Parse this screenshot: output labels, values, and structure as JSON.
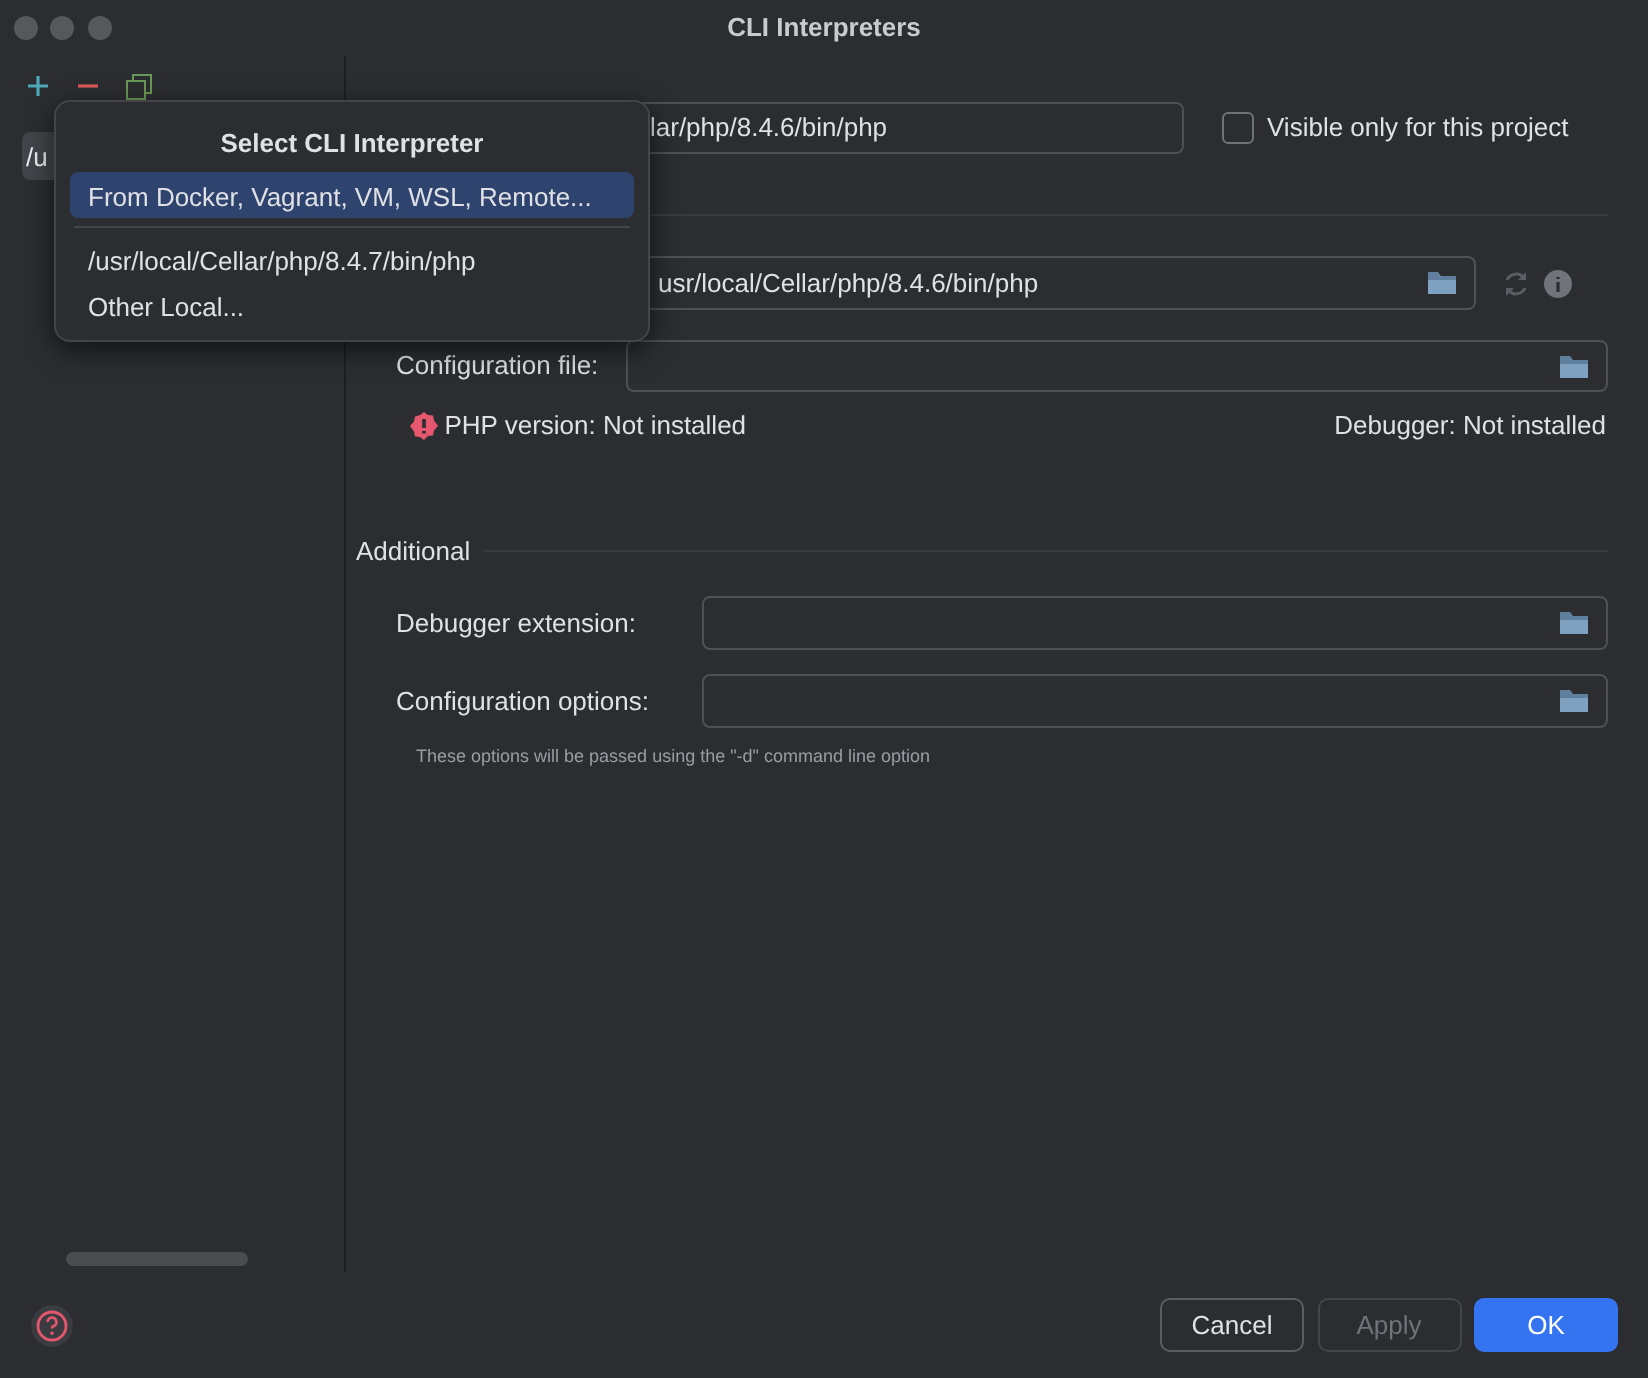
{
  "window": {
    "title": "CLI Interpreters"
  },
  "interpreters": [
    {
      "label": "/u",
      "selected": true
    }
  ],
  "popup": {
    "title": "Select CLI Interpreter",
    "groups": [
      [
        {
          "label": "From Docker, Vagrant, VM, WSL, Remote...",
          "selected": true
        }
      ],
      [
        {
          "label": "/usr/local/Cellar/php/8.4.7/bin/php",
          "selected": false
        },
        {
          "label": "Other Local...",
          "selected": false
        }
      ]
    ]
  },
  "name_field": {
    "value": "lar/php/8.4.6/bin/php"
  },
  "visible_only": {
    "label": "Visible only for this project",
    "checked": false
  },
  "executable_field": {
    "value": "usr/local/Cellar/php/8.4.6/bin/php"
  },
  "config_file": {
    "label": "Configuration file:"
  },
  "php_version": {
    "text": "PHP version: Not installed",
    "error": true
  },
  "debugger_status": "Debugger: Not installed",
  "additional": {
    "title": "Additional",
    "fields": [
      {
        "label": "Debugger extension:"
      },
      {
        "label": "Configuration options:"
      }
    ],
    "hint": "These options will be passed using the \"-d\" command line option"
  },
  "buttons": [
    {
      "label": "Cancel",
      "kind": "default",
      "disabled": false
    },
    {
      "label": "Apply",
      "kind": "default",
      "disabled": true
    },
    {
      "label": "OK",
      "kind": "primary",
      "disabled": false
    }
  ]
}
